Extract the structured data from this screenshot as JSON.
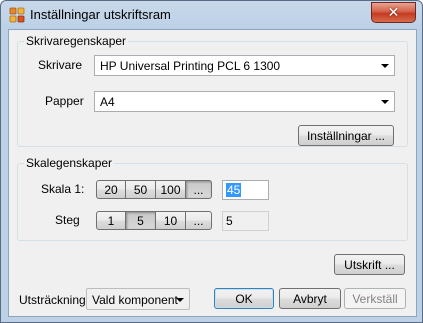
{
  "window": {
    "title": "Inställningar utskriftsram",
    "close_symbol": "✕",
    "icon": "settings-app-icon"
  },
  "printer_group": {
    "title": "Skrivaregenskaper",
    "printer_label": "Skrivare",
    "printer_value": "HP Universal Printing PCL 6 1300",
    "paper_label": "Papper",
    "paper_value": "A4",
    "settings_button": "Inställningar ..."
  },
  "scale_group": {
    "title": "Skalegenskaper",
    "scale_label": "Skala 1:",
    "scale_presets": [
      "20",
      "50",
      "100",
      "..."
    ],
    "scale_value": "45",
    "step_label": "Steg",
    "step_presets": [
      "1",
      "5",
      "10",
      "..."
    ],
    "step_value": "5"
  },
  "footer": {
    "print_button": "Utskrift ...",
    "extent_label": "Utsträckning",
    "extent_value": "Vald komponent",
    "ok_button": "OK",
    "cancel_button": "Avbryt",
    "apply_button": "Verkställ"
  },
  "colors": {
    "titlebar": "#bcd0e6",
    "close_button": "#c43a21",
    "selection": "#3399ff",
    "default_button_border": "#3c7fb1"
  }
}
